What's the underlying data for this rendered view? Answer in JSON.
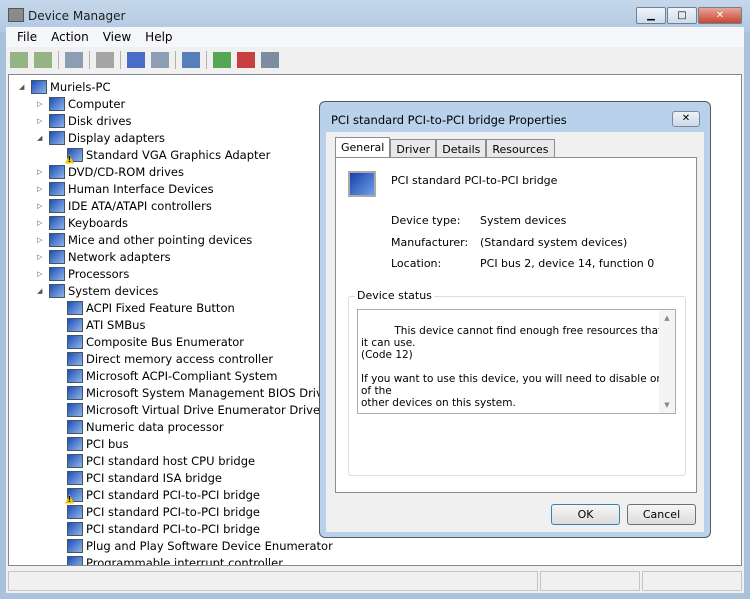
{
  "window": {
    "title": "Device Manager",
    "min": "▁",
    "max": "□",
    "close": "✕"
  },
  "menu": [
    "File",
    "Action",
    "View",
    "Help"
  ],
  "toolbar": [
    "back-icon",
    "forward-icon",
    "console-tree-icon",
    "properties-icon",
    "help-icon",
    "action-pane-icon",
    "scan-hardware-icon",
    "update-driver-icon",
    "uninstall-icon",
    "disable-icon"
  ],
  "tree": [
    {
      "label": "Muriels-PC",
      "level": 0,
      "exp": "◢"
    },
    {
      "label": "Computer",
      "level": 1,
      "exp": "▷"
    },
    {
      "label": "Disk drives",
      "level": 1,
      "exp": "▷"
    },
    {
      "label": "Display adapters",
      "level": 1,
      "exp": "◢"
    },
    {
      "label": "Standard VGA Graphics Adapter",
      "level": 2,
      "warn": true
    },
    {
      "label": "DVD/CD-ROM drives",
      "level": 1,
      "exp": "▷"
    },
    {
      "label": "Human Interface Devices",
      "level": 1,
      "exp": "▷"
    },
    {
      "label": "IDE ATA/ATAPI controllers",
      "level": 1,
      "exp": "▷"
    },
    {
      "label": "Keyboards",
      "level": 1,
      "exp": "▷"
    },
    {
      "label": "Mice and other pointing devices",
      "level": 1,
      "exp": "▷"
    },
    {
      "label": "Network adapters",
      "level": 1,
      "exp": "▷"
    },
    {
      "label": "Processors",
      "level": 1,
      "exp": "▷"
    },
    {
      "label": "System devices",
      "level": 1,
      "exp": "◢"
    },
    {
      "label": "ACPI Fixed Feature Button",
      "level": 2
    },
    {
      "label": "ATI SMBus",
      "level": 2
    },
    {
      "label": "Composite Bus Enumerator",
      "level": 2
    },
    {
      "label": "Direct memory access controller",
      "level": 2
    },
    {
      "label": "Microsoft ACPI-Compliant System",
      "level": 2
    },
    {
      "label": "Microsoft System Management BIOS Driver",
      "level": 2
    },
    {
      "label": "Microsoft Virtual Drive Enumerator Driver",
      "level": 2
    },
    {
      "label": "Numeric data processor",
      "level": 2
    },
    {
      "label": "PCI bus",
      "level": 2
    },
    {
      "label": "PCI standard host CPU bridge",
      "level": 2
    },
    {
      "label": "PCI standard ISA bridge",
      "level": 2
    },
    {
      "label": "PCI standard PCI-to-PCI bridge",
      "level": 2,
      "warn": true
    },
    {
      "label": "PCI standard PCI-to-PCI bridge",
      "level": 2
    },
    {
      "label": "PCI standard PCI-to-PCI bridge",
      "level": 2
    },
    {
      "label": "Plug and Play Software Device Enumerator",
      "level": 2
    },
    {
      "label": "Programmable interrupt controller",
      "level": 2
    }
  ],
  "dialog": {
    "title": "PCI standard PCI-to-PCI bridge Properties",
    "close": "✕",
    "tabs": [
      "General",
      "Driver",
      "Details",
      "Resources"
    ],
    "device_name": "PCI standard PCI-to-PCI bridge",
    "props": [
      {
        "k": "Device type:",
        "v": "System devices"
      },
      {
        "k": "Manufacturer:",
        "v": "(Standard system devices)"
      },
      {
        "k": "Location:",
        "v": "PCI bus 2, device 14, function 0"
      }
    ],
    "status_label": "Device status",
    "status_text": "This device cannot find enough free resources that it can use.\n(Code 12)\n\nIf you want to use this device, you will need to disable one of the\nother devices on this system.",
    "ok": "OK",
    "cancel": "Cancel"
  }
}
